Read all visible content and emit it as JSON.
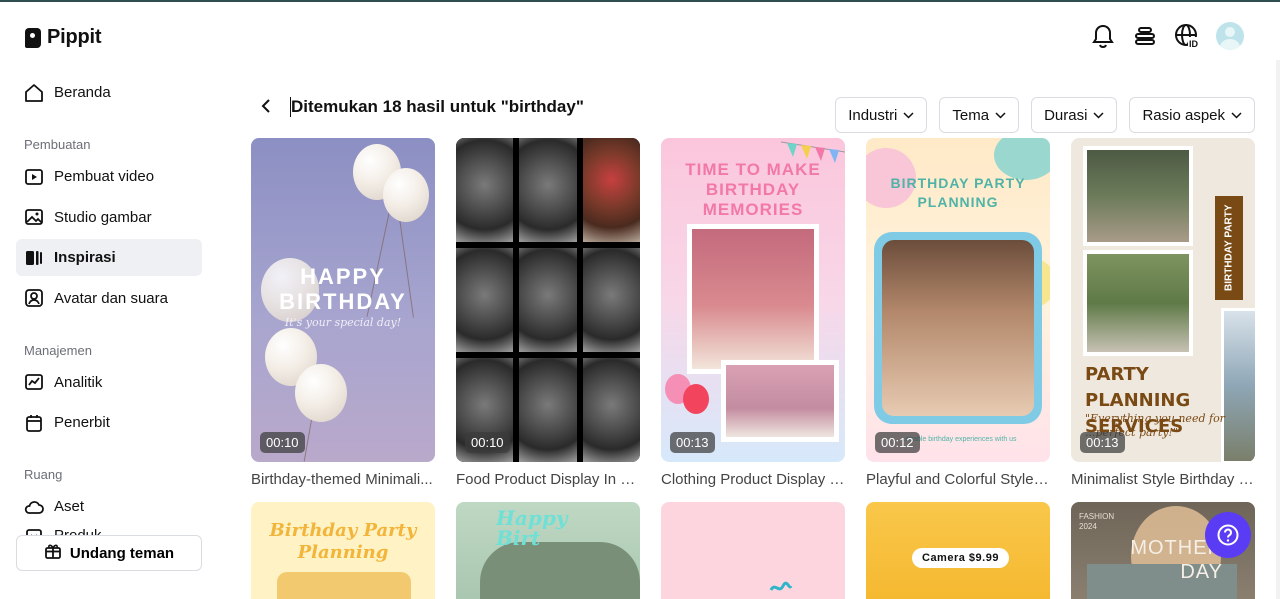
{
  "brand": {
    "name": "Pippit"
  },
  "header": {
    "icons": [
      "bell-icon",
      "stack-icon",
      "globe-language-icon",
      "user-avatar"
    ],
    "language_badge": "ID"
  },
  "sidebar": {
    "home": "Beranda",
    "sections": [
      {
        "label": "Pembuatan",
        "items": [
          "Pembuat video",
          "Studio gambar",
          "Inspirasi",
          "Avatar dan suara"
        ]
      },
      {
        "label": "Manajemen",
        "items": [
          "Analitik",
          "Penerbit"
        ]
      },
      {
        "label": "Ruang",
        "items": [
          "Aset",
          "Produk"
        ]
      }
    ],
    "active_item": "Inspirasi",
    "invite_label": "Undang teman"
  },
  "main": {
    "results_title": "Ditemukan 18 hasil untuk \"birthday\"",
    "filters": [
      "Industri",
      "Tema",
      "Durasi",
      "Rasio aspek"
    ],
    "cards": [
      {
        "title": "Birthday-themed Minimali...",
        "duration": "00:10",
        "art_title": "HAPPY BIRTHDAY",
        "art_subtitle": "It's your special day!"
      },
      {
        "title": "Food Product Display In S...",
        "duration": "00:10"
      },
      {
        "title": "Clothing Product Display B...",
        "duration": "00:13",
        "art_title": "TIME TO MAKE BIRTHDAY MEMORIES"
      },
      {
        "title": "Playful and Colorful Style ...",
        "duration": "00:12",
        "art_title": "BIRTHDAY PARTY PLANNING",
        "art_subtitle": "...ettable birthday experiences with us"
      },
      {
        "title": "Minimalist Style Birthday P...",
        "duration": "00:13",
        "art_title": "PARTY PLANNING SERVICES",
        "art_subtitle": "\"Everything you need for ...perfect party!\"",
        "ribbon": "BIRTHDAY PARTY"
      }
    ],
    "row2": [
      {
        "art_title": "Birthday Party Planning"
      },
      {
        "art_title": "Happy Birt"
      },
      {
        "art_title": ""
      },
      {
        "art_title": "Camera $9.99"
      },
      {
        "art_title": "MOTHER DAY",
        "art_subtitle": "FASHION 2024"
      }
    ]
  },
  "help_icon": "question-help-icon"
}
